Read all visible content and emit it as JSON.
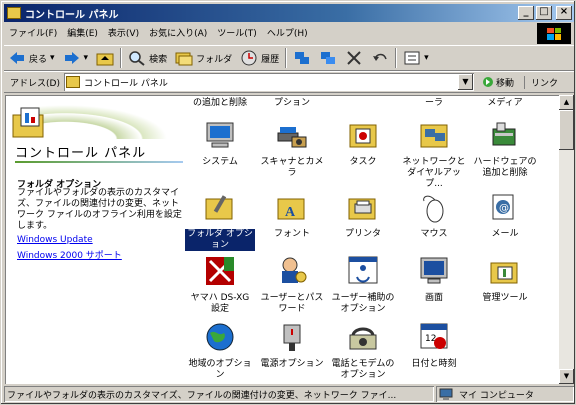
{
  "window": {
    "title": "コントロール パネル"
  },
  "title_buttons": {
    "minimize": "_",
    "maximize": "□",
    "close": "×"
  },
  "menu": [
    "ファイル(F)",
    "編集(E)",
    "表示(V)",
    "お気に入り(A)",
    "ツール(T)",
    "ヘルプ(H)"
  ],
  "toolbar": {
    "back": "戻る",
    "search": "検索",
    "folders": "フォルダ",
    "history": "履歴"
  },
  "address": {
    "label": "アドレス(D)",
    "value": "コントロール パネル",
    "go": "移動",
    "links": "リンク"
  },
  "pane": {
    "title": "コントロール パネル",
    "desc_title": "フォルダ オプション",
    "desc": "ファイルやフォルダの表示のカスタマイズ、ファイルの関連付けの変更、ネットワーク ファイルのオフライン利用を設定します。",
    "links": [
      "Windows Update",
      "Windows 2000 サポート"
    ]
  },
  "cut_row": [
    "の追加と削除",
    "プション",
    "ーラ",
    "メディア"
  ],
  "items": [
    {
      "label": "システム",
      "icon": "system-icon"
    },
    {
      "label": "スキャナとカメラ",
      "icon": "scanner-camera-icon"
    },
    {
      "label": "タスク",
      "icon": "scheduled-tasks-icon"
    },
    {
      "label": "ネットワークとダイヤルアップ...",
      "icon": "network-dialup-icon"
    },
    {
      "label": "ハードウェアの追加と削除",
      "icon": "add-hardware-icon"
    },
    {
      "label": "フォルダ オプション",
      "icon": "folder-options-icon"
    },
    {
      "label": "フォント",
      "icon": "fonts-icon"
    },
    {
      "label": "プリンタ",
      "icon": "printers-icon"
    },
    {
      "label": "マウス",
      "icon": "mouse-icon"
    },
    {
      "label": "メール",
      "icon": "mail-icon"
    },
    {
      "label": "ヤマハ DS-XG 設定",
      "icon": "yamaha-ds-xg-icon"
    },
    {
      "label": "ユーザーとパスワード",
      "icon": "users-passwords-icon"
    },
    {
      "label": "ユーザー補助のオプション",
      "icon": "accessibility-icon"
    },
    {
      "label": "画面",
      "icon": "display-icon"
    },
    {
      "label": "管理ツール",
      "icon": "admin-tools-icon"
    },
    {
      "label": "地域のオプション",
      "icon": "regional-options-icon"
    },
    {
      "label": "電源オプション",
      "icon": "power-options-icon"
    },
    {
      "label": "電話とモデムのオプション",
      "icon": "phone-modem-icon"
    },
    {
      "label": "日付と時刻",
      "icon": "date-time-icon"
    }
  ],
  "status": {
    "text": "ファイルやフォルダの表示のカスタマイズ、ファイルの関連付けの変更、ネットワーク ファイ...",
    "zone": "マイ コンピュータ"
  }
}
